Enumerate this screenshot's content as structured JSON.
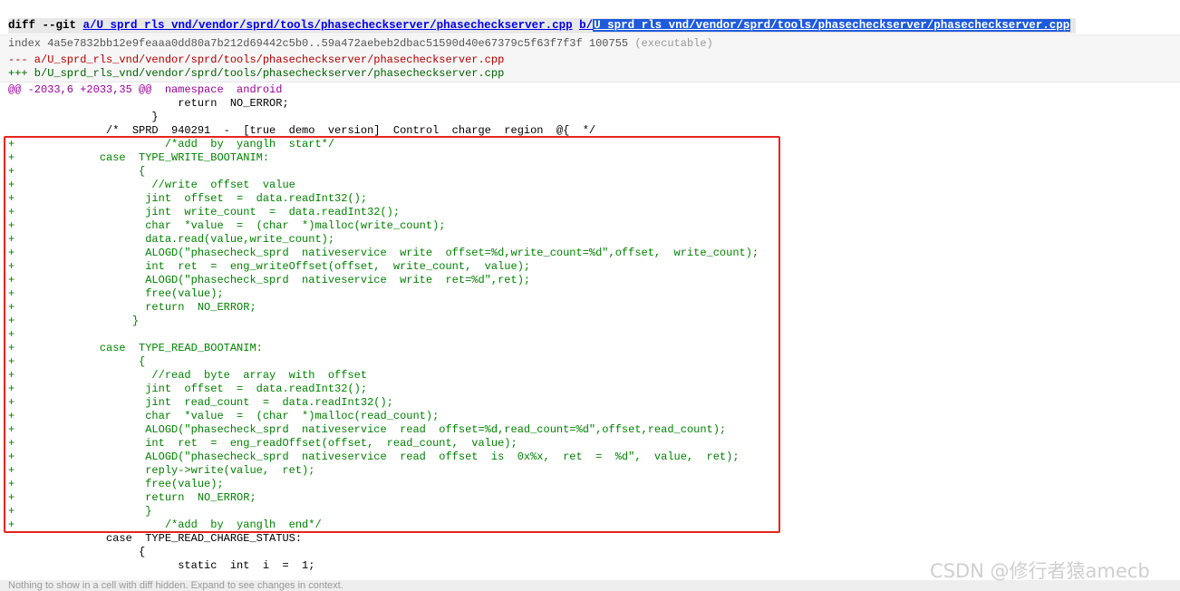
{
  "diff_header": {
    "prefix": "diff --git ",
    "path_a": "a/U_sprd_rls_vnd/vendor/sprd/tools/phasecheckserver/phasecheckserver.cpp",
    "b_prefix": "b/",
    "path_b_selected": "U_sprd_rls_vnd/vendor/sprd/tools/phasecheckserver/phasecheckserver.cpp"
  },
  "index_line": {
    "text": "index 4a5e7832bb12e9feaaa0dd80a7b212d69442c5b0..59a472aebeb2dbac51590d40e67379c5f63f7f3f 100755",
    "mode_note": "(executable)"
  },
  "old_file": "--- a/U_sprd_rls_vnd/vendor/sprd/tools/phasecheckserver/phasecheckserver.cpp",
  "new_file": "+++ b/U_sprd_rls_vnd/vendor/sprd/tools/phasecheckserver/phasecheckserver.cpp",
  "hunk": {
    "range": "@@ -2033,6 +2033,35 @@",
    "context": "namespace  android"
  },
  "context_before": [
    "                          return  NO_ERROR;",
    "                      }",
    "               /*  SPRD  940291  -  [true  demo  version]  Control  charge  region  @{  */"
  ],
  "added_marker": "+",
  "added_lines": [
    "                        /*add  by  yanglh  start*/",
    "              case  TYPE_WRITE_BOOTANIM:",
    "                    {",
    "                      //write  offset  value",
    "                     jint  offset  =  data.readInt32();",
    "                     jint  write_count  =  data.readInt32();",
    "                     char  *value  =  (char  *)malloc(write_count);",
    "                     data.read(value,write_count);",
    "                     ALOGD(\"phasecheck_sprd  nativeservice  write  offset=%d,write_count=%d\",offset,  write_count);",
    "                     int  ret  =  eng_writeOffset(offset,  write_count,  value);",
    "                     ALOGD(\"phasecheck_sprd  nativeservice  write  ret=%d\",ret);",
    "                     free(value);",
    "                     return  NO_ERROR;",
    "                   }",
    "",
    "              case  TYPE_READ_BOOTANIM:",
    "                    {",
    "                      //read  byte  array  with  offset",
    "                     jint  offset  =  data.readInt32();",
    "                     jint  read_count  =  data.readInt32();",
    "                     char  *value  =  (char  *)malloc(read_count);",
    "                     ALOGD(\"phasecheck_sprd  nativeservice  read  offset=%d,read_count=%d\",offset,read_count);",
    "                     int  ret  =  eng_readOffset(offset,  read_count,  value);",
    "                     ALOGD(\"phasecheck_sprd  nativeservice  read  offset  is  0x%x,  ret  =  %d\",  value,  ret);",
    "                     reply->write(value,  ret);",
    "                     free(value);",
    "                     return  NO_ERROR;",
    "                     }",
    "                        /*add  by  yanglh  end*/"
  ],
  "context_after": [
    "               case  TYPE_READ_CHARGE_STATUS:",
    "                    {",
    "                          static  int  i  =  1;"
  ],
  "bottom_hint": "Nothing to show in a cell with diff hidden. Expand to see changes in context.",
  "watermark": "CSDN @修行者猿amecb",
  "colors": {
    "added": "#008000",
    "removed": "#b00000",
    "hunk": "#990099",
    "highlight_box": "#e8251f",
    "selection": "#1e5adc"
  }
}
